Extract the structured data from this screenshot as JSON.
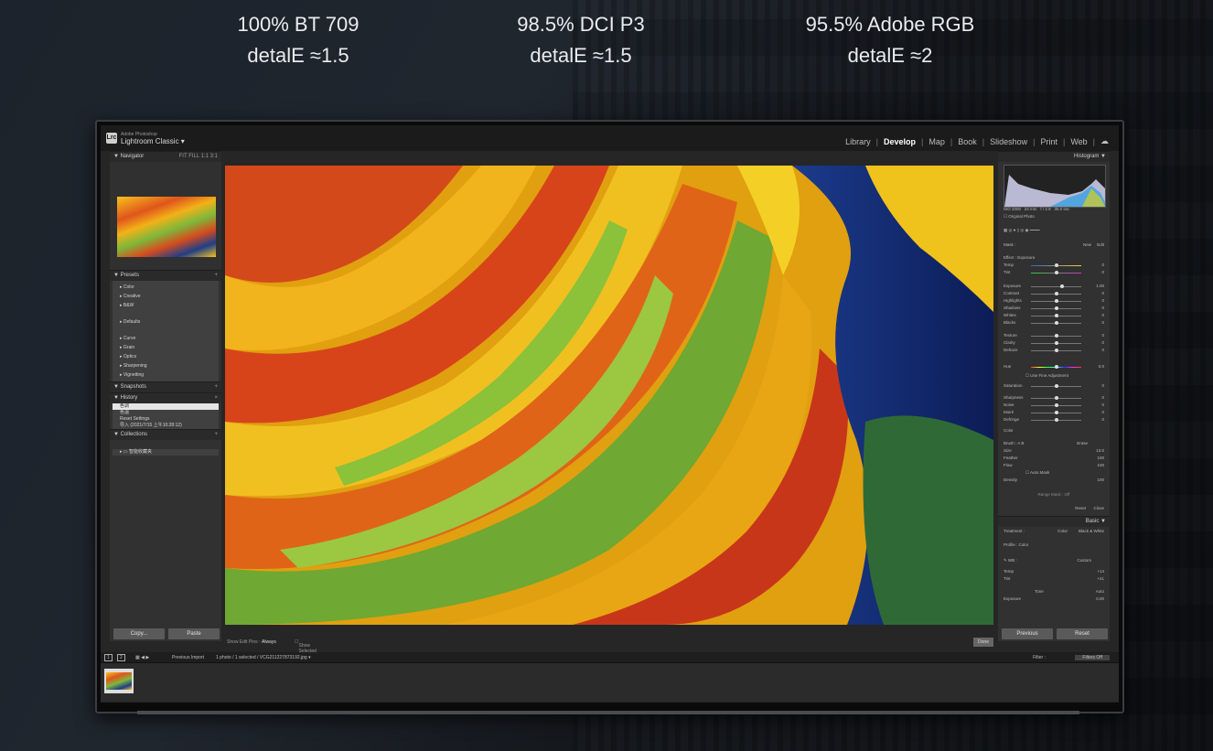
{
  "specs": [
    {
      "line1": "100% BT 709",
      "line2": "detalE ≈1.5"
    },
    {
      "line1": "98.5% DCI P3",
      "line2": "detalE ≈1.5"
    },
    {
      "line1": "95.5% Adobe RGB",
      "line2": "detalE ≈2"
    }
  ],
  "app": {
    "badge": "Lrc",
    "vendor": "Adobe Photoshop",
    "title": "Lightroom Classic ▾",
    "modules": [
      "Library",
      "Develop",
      "Map",
      "Book",
      "Slideshow",
      "Print",
      "Web"
    ],
    "active_module": "Develop"
  },
  "left_panel": {
    "navigator": {
      "title": "Navigator",
      "zoom": "FIT  FILL  1:1  3:1"
    },
    "presets": {
      "title": "Presets",
      "items": [
        "Color",
        "Creative",
        "B&W",
        "Defaults",
        "Curve",
        "Grain",
        "Optics",
        "Sharpening",
        "Vignetting"
      ]
    },
    "snapshots": {
      "title": "Snapshots"
    },
    "history": {
      "title": "History",
      "items": [
        "色调",
        "色温",
        "Reset Settings",
        "导入 (2021/7/15 上午10:28:12)"
      ]
    },
    "collections": {
      "title": "Collections",
      "item": "智能收藏夹"
    },
    "copy_label": "Copy...",
    "paste_label": "Paste"
  },
  "toolbar": {
    "show_edit_pins": "Show Edit Pins :",
    "edit_pins_value": "Always",
    "overlay": "Show Selected Mask Overlay",
    "done": "Done"
  },
  "right_panel": {
    "histogram": {
      "title": "Histogram",
      "iso": "ISO 2000",
      "focal": "24 mm",
      "aperture": "f / 2.8",
      "shutter": "30.0 sec",
      "original": "Original Photo"
    },
    "mask": {
      "label": "Mask :",
      "new": "New",
      "edit": "Edit"
    },
    "effect": {
      "label": "Effect :",
      "value": "Exposure"
    },
    "sliders": [
      {
        "name": "Temp",
        "value": "0",
        "pos": 0.5
      },
      {
        "name": "Tint",
        "value": "0",
        "pos": 0.5
      },
      {
        "name": "Exposure",
        "value": "1.00",
        "pos": 0.62
      },
      {
        "name": "Contrast",
        "value": "0",
        "pos": 0.5
      },
      {
        "name": "Highlights",
        "value": "0",
        "pos": 0.5
      },
      {
        "name": "Shadows",
        "value": "0",
        "pos": 0.5
      },
      {
        "name": "Whites",
        "value": "0",
        "pos": 0.5
      },
      {
        "name": "Blacks",
        "value": "0",
        "pos": 0.5
      },
      {
        "name": "Texture",
        "value": "0",
        "pos": 0.5
      },
      {
        "name": "Clarity",
        "value": "0",
        "pos": 0.5
      },
      {
        "name": "Dehaze",
        "value": "0",
        "pos": 0.5
      },
      {
        "name": "Hue",
        "value": "0.0",
        "pos": 0.5
      },
      {
        "name": "Saturation",
        "value": "0",
        "pos": 0.5
      },
      {
        "name": "Sharpness",
        "value": "0",
        "pos": 0.5
      },
      {
        "name": "Noise",
        "value": "0",
        "pos": 0.5
      },
      {
        "name": "Moiré",
        "value": "0",
        "pos": 0.5
      },
      {
        "name": "Defringe",
        "value": "0",
        "pos": 0.5
      }
    ],
    "fine_adjust": "Use Fine Adjustment",
    "color_label": "Color",
    "brush": {
      "label": "Brush :",
      "a": "A",
      "b": "B",
      "erase": "Erase",
      "size": "13.0",
      "feather": "100",
      "flow": "100",
      "density": "100",
      "auto_mask": "Auto Mask"
    },
    "range_mask": "Range Mask : Off",
    "reset": "Reset",
    "close": "Close",
    "basic": {
      "title": "Basic",
      "treatment": "Treatment :",
      "color": "Color",
      "bw": "Black & White",
      "profile": "Profile :",
      "profile_value": "Color",
      "wb": "WB :",
      "wb_value": "Custom",
      "temp_val": "+14",
      "tint_val": "+41",
      "tone": "Tone",
      "auto": "Auto",
      "exposure": "0.00"
    },
    "previous": "Previous",
    "reset_btn": "Reset"
  },
  "filmstrip": {
    "views": [
      "1",
      "2"
    ],
    "source": "Previous Import",
    "info": "1 photo / 1 selected / VCG211227873192.jpg ▾",
    "filter_label": "Filter :",
    "filter_value": "Filters Off"
  }
}
